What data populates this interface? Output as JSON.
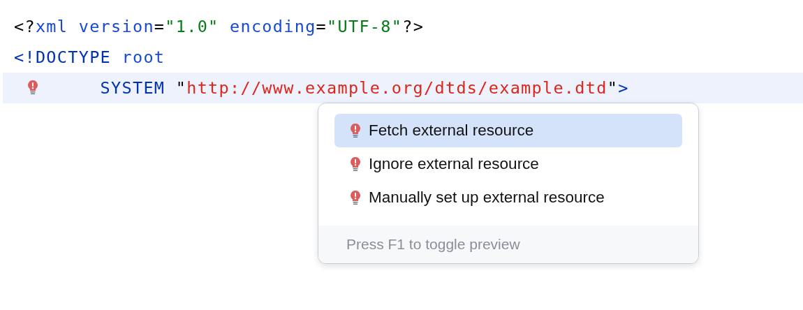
{
  "editor": {
    "lines": [
      {
        "tokens": [
          {
            "kind": "punct",
            "text": "<?"
          },
          {
            "kind": "attr",
            "text": "xml version"
          },
          {
            "kind": "punct",
            "text": "="
          },
          {
            "kind": "value",
            "text": "\"1.0\""
          },
          {
            "kind": "attr",
            "text": " encoding"
          },
          {
            "kind": "punct",
            "text": "="
          },
          {
            "kind": "value",
            "text": "\"UTF-8\""
          },
          {
            "kind": "punct",
            "text": "?>"
          }
        ],
        "highlighted": false,
        "warning": false
      },
      {
        "tokens": [
          {
            "kind": "tag",
            "text": "<!DOCTYPE"
          },
          {
            "kind": "attr",
            "text": " root"
          }
        ],
        "highlighted": false,
        "warning": false
      },
      {
        "tokens": [
          {
            "kind": "tag",
            "text": "        SYSTEM "
          },
          {
            "kind": "punct",
            "text": "\""
          },
          {
            "kind": "url",
            "text": "http://www.example.org/dtds/example.dtd"
          },
          {
            "kind": "punct",
            "text": "\""
          },
          {
            "kind": "tag",
            "text": ">"
          }
        ],
        "highlighted": true,
        "warning": true
      }
    ]
  },
  "popup": {
    "items": [
      {
        "label": "Fetch external resource",
        "selected": true
      },
      {
        "label": "Ignore external resource",
        "selected": false
      },
      {
        "label": "Manually set up external resource",
        "selected": false
      }
    ],
    "footer": "Press F1 to toggle preview"
  }
}
